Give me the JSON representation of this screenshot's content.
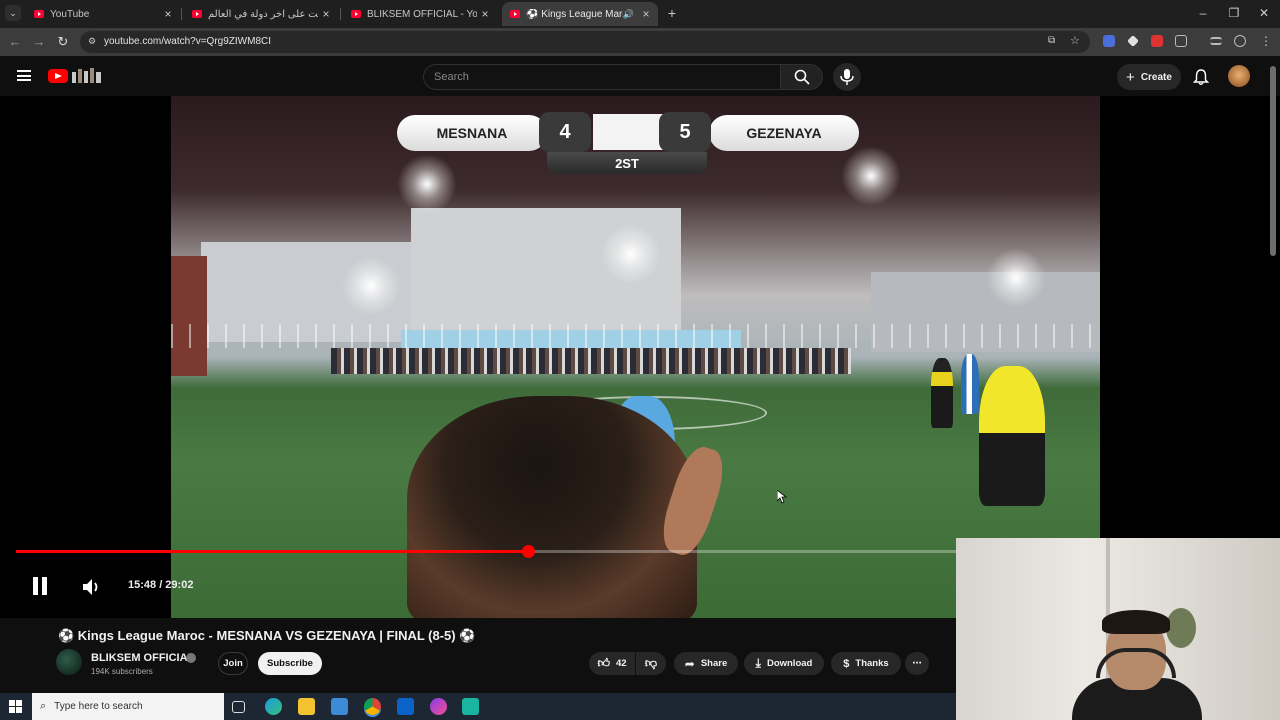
{
  "browser": {
    "tabs": [
      {
        "label": "YouTube",
        "active": false
      },
      {
        "label": "وصلت على آخر دولة في العالم -",
        "active": false
      },
      {
        "label": "BLIKSEM OFFICIAL - YouTube",
        "active": false
      },
      {
        "label": "⚽ Kings League Maroc - M",
        "active": true
      }
    ],
    "new_tab": "+",
    "url": "youtube.com/watch?v=Qrg9ZIWM8CI"
  },
  "masthead": {
    "search_placeholder": "Search",
    "create_label": "Create"
  },
  "scoreboard": {
    "home_team": "MESNANA",
    "home_score": "4",
    "away_team": "GEZENAYA",
    "away_score": "5",
    "period": "2ST"
  },
  "player": {
    "current_time": "15:48",
    "duration": "29:02",
    "time_display": "15:48 / 29:02",
    "progress_fraction": 0.5445,
    "state": "playing"
  },
  "video": {
    "title": "⚽ Kings League Maroc - MESNANA VS GEZENAYA | FINAL (8-5) ⚽",
    "channel": "BLIKSEM OFFICIAL",
    "subscribers": "194K subscribers",
    "join_label": "Join",
    "subscribe_label": "Subscribe",
    "likes": "42",
    "share_label": "Share",
    "download_label": "Download",
    "thanks_label": "Thanks"
  },
  "taskbar": {
    "search_placeholder": "Type here to search"
  },
  "colors": {
    "accent_red": "#ff0000",
    "background": "#0f0f0f"
  }
}
